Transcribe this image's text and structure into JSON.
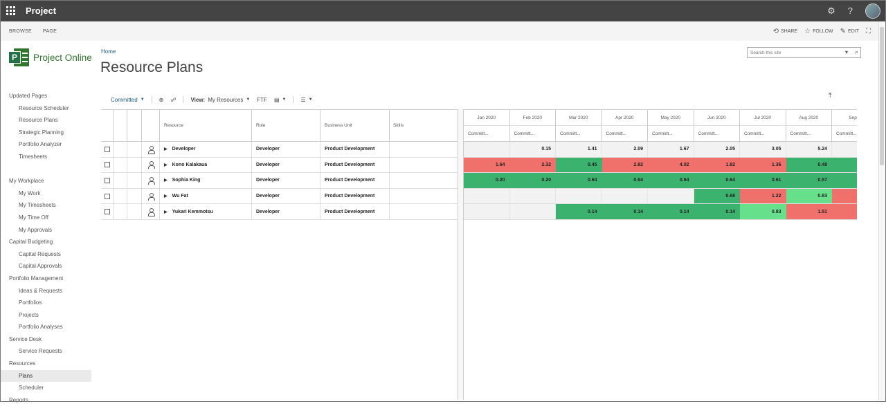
{
  "suite": {
    "title": "Project",
    "settings_icon": "gear-icon",
    "help_label": "?",
    "avatar": "user-avatar"
  },
  "ribbon": {
    "tabs": [
      "BROWSE",
      "PAGE"
    ],
    "share": "SHARE",
    "follow": "FOLLOW",
    "edit": "EDIT"
  },
  "logo": {
    "text": "Project Online",
    "letter": "P"
  },
  "nav": [
    {
      "label": "Updated Pages",
      "level": 0
    },
    {
      "label": "Resource Scheduler",
      "level": 1
    },
    {
      "label": "Resource Plans",
      "level": 1
    },
    {
      "label": "Strategic Planning",
      "level": 1
    },
    {
      "label": "Portfolio Analyzer",
      "level": 1
    },
    {
      "label": "Timesheets",
      "level": 1
    },
    {
      "label": "",
      "level": 0
    },
    {
      "label": "My Workplace",
      "level": 0
    },
    {
      "label": "My Work",
      "level": 1
    },
    {
      "label": "My Timesheets",
      "level": 1
    },
    {
      "label": "My Time Off",
      "level": 1
    },
    {
      "label": "My Approvals",
      "level": 1
    },
    {
      "label": "Capital Budgeting",
      "level": 0
    },
    {
      "label": "Capital Requests",
      "level": 1
    },
    {
      "label": "Capital Approvals",
      "level": 1
    },
    {
      "label": "Portfolio Management",
      "level": 0
    },
    {
      "label": "Ideas & Requests",
      "level": 1
    },
    {
      "label": "Portfolios",
      "level": 1
    },
    {
      "label": "Projects",
      "level": 1
    },
    {
      "label": "Portfolio Analyses",
      "level": 1
    },
    {
      "label": "Service Desk",
      "level": 0
    },
    {
      "label": "Service Requests",
      "level": 1
    },
    {
      "label": "Resources",
      "level": 0
    },
    {
      "label": "Plans",
      "level": 1,
      "selected": true
    },
    {
      "label": "Scheduler",
      "level": 1
    },
    {
      "label": "Reports",
      "level": 0
    }
  ],
  "header": {
    "breadcrumb": "Home",
    "title": "Resource Plans",
    "search_placeholder": "Search this site"
  },
  "toolbar": {
    "committed": "Committed",
    "view_label": "View:",
    "view_value": "My Resources",
    "ftf": "FTF"
  },
  "table": {
    "columns": {
      "resource": "Resource",
      "role": "Role",
      "business_unit": "Business Unit",
      "skills": "Skills"
    },
    "rows": [
      {
        "name": "Developer",
        "role": "Developer",
        "bu": "Product Development",
        "icon": "team-icon"
      },
      {
        "name": "Kono Kalakaua",
        "role": "Developer",
        "bu": "Product Development",
        "icon": "person-icon"
      },
      {
        "name": "Sophia King",
        "role": "Developer",
        "bu": "Product Development",
        "icon": "person-icon"
      },
      {
        "name": "Wu Fat",
        "role": "Developer",
        "bu": "Product Development",
        "icon": "person-icon"
      },
      {
        "name": "Yukari Kemmotsu",
        "role": "Developer",
        "bu": "Product Development",
        "icon": "team-icon"
      }
    ]
  },
  "timeline": {
    "months": [
      "Jan 2020",
      "Feb 2020",
      "Mar 2020",
      "Apr 2020",
      "May 2020",
      "Jun 2020",
      "Jul 2020",
      "Aug 2020",
      "Sep 2"
    ],
    "subheader": "Committ...",
    "rows": [
      [
        {
          "v": "",
          "c": "grey"
        },
        {
          "v": "0.15",
          "c": "grey"
        },
        {
          "v": "1.41",
          "c": "grey"
        },
        {
          "v": "2.09",
          "c": "grey"
        },
        {
          "v": "1.67",
          "c": "grey"
        },
        {
          "v": "2.05",
          "c": "grey"
        },
        {
          "v": "3.05",
          "c": "grey"
        },
        {
          "v": "5.24",
          "c": "grey"
        },
        {
          "v": "",
          "c": "grey"
        }
      ],
      [
        {
          "v": "1.64",
          "c": "red"
        },
        {
          "v": "2.32",
          "c": "red"
        },
        {
          "v": "0.45",
          "c": "green"
        },
        {
          "v": "2.82",
          "c": "red"
        },
        {
          "v": "4.02",
          "c": "red"
        },
        {
          "v": "1.82",
          "c": "red"
        },
        {
          "v": "1.36",
          "c": "red"
        },
        {
          "v": "0.48",
          "c": "green"
        },
        {
          "v": "",
          "c": "green"
        }
      ],
      [
        {
          "v": "0.20",
          "c": "green"
        },
        {
          "v": "0.20",
          "c": "green"
        },
        {
          "v": "0.64",
          "c": "green"
        },
        {
          "v": "0.64",
          "c": "green"
        },
        {
          "v": "0.64",
          "c": "green"
        },
        {
          "v": "0.64",
          "c": "green"
        },
        {
          "v": "0.61",
          "c": "green"
        },
        {
          "v": "0.57",
          "c": "green"
        },
        {
          "v": "",
          "c": "green"
        }
      ],
      [
        {
          "v": "",
          "c": "grey"
        },
        {
          "v": "",
          "c": "grey"
        },
        {
          "v": "",
          "c": "grey"
        },
        {
          "v": "",
          "c": "grey"
        },
        {
          "v": "",
          "c": "grey"
        },
        {
          "v": "0.68",
          "c": "green"
        },
        {
          "v": "1.22",
          "c": "red"
        },
        {
          "v": "0.83",
          "c": "lightgreen"
        },
        {
          "v": "",
          "c": "red"
        }
      ],
      [
        {
          "v": "",
          "c": "grey"
        },
        {
          "v": "",
          "c": "grey"
        },
        {
          "v": "0.14",
          "c": "green"
        },
        {
          "v": "0.14",
          "c": "green"
        },
        {
          "v": "0.14",
          "c": "green"
        },
        {
          "v": "0.14",
          "c": "green"
        },
        {
          "v": "0.83",
          "c": "lightgreen"
        },
        {
          "v": "1.51",
          "c": "red"
        },
        {
          "v": "",
          "c": "red"
        }
      ]
    ]
  },
  "colors": {
    "over": "#f0706b",
    "under": "#3bb36f",
    "near": "#67e08b",
    "brand": "#31752f"
  }
}
